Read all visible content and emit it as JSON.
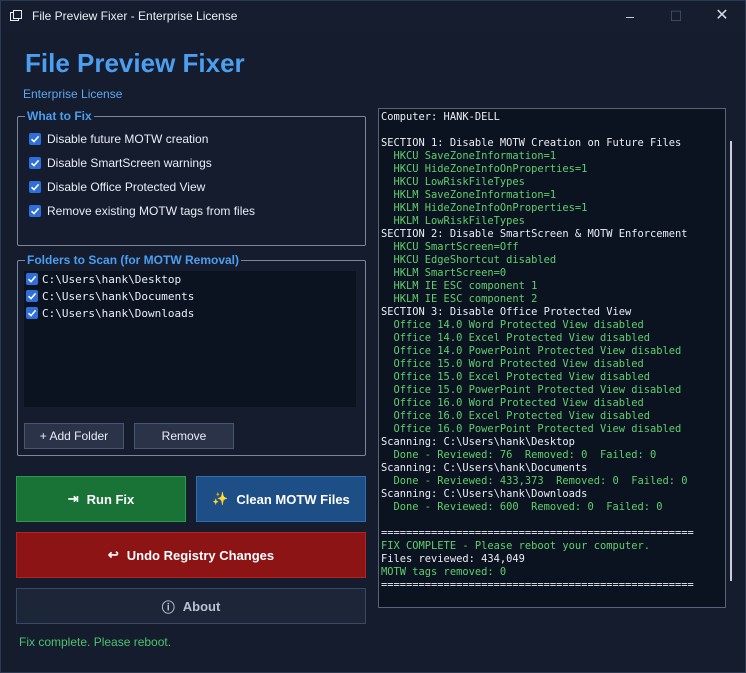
{
  "window": {
    "title": "File Preview Fixer - Enterprise License",
    "minimize_glyph": "–",
    "maximize_glyph": "☐",
    "close_glyph": "✕"
  },
  "header": {
    "title": "File Preview Fixer",
    "subtitle": "Enterprise License"
  },
  "what_to_fix": {
    "legend": "What to Fix",
    "options": [
      {
        "label": "Disable future MOTW creation",
        "checked": true
      },
      {
        "label": "Disable SmartScreen warnings",
        "checked": true
      },
      {
        "label": "Disable Office Protected View",
        "checked": true
      },
      {
        "label": "Remove existing MOTW tags from files",
        "checked": true
      }
    ]
  },
  "folders": {
    "legend": "Folders to Scan (for MOTW Removal)",
    "items": [
      {
        "path": "C:\\Users\\hank\\Desktop",
        "checked": true
      },
      {
        "path": "C:\\Users\\hank\\Documents",
        "checked": true
      },
      {
        "path": "C:\\Users\\hank\\Downloads",
        "checked": true
      }
    ],
    "add_label": "+ Add Folder",
    "remove_label": "Remove"
  },
  "actions": {
    "run_label": "Run Fix",
    "run_icon": "⇥",
    "clean_label": "Clean MOTW Files",
    "clean_icon": "✨",
    "undo_label": "Undo Registry Changes",
    "undo_icon": "↩",
    "about_label": "About",
    "about_icon": "ⓘ"
  },
  "status": "Fix complete. Please reboot.",
  "colors": {
    "accent": "#4c9ef0",
    "run": "#197336",
    "clean": "#1d4f86",
    "undo": "#8c1414",
    "log_green": "#5fcf6f"
  },
  "log": [
    {
      "text": "Computer: HANK-DELL",
      "tone": "white"
    },
    {
      "text": "",
      "tone": "white"
    },
    {
      "text": "SECTION 1: Disable MOTW Creation on Future Files",
      "tone": "white"
    },
    {
      "text": "  HKCU SaveZoneInformation=1",
      "tone": "green"
    },
    {
      "text": "  HKCU HideZoneInfoOnProperties=1",
      "tone": "green"
    },
    {
      "text": "  HKCU LowRiskFileTypes",
      "tone": "green"
    },
    {
      "text": "  HKLM SaveZoneInformation=1",
      "tone": "green"
    },
    {
      "text": "  HKLM HideZoneInfoOnProperties=1",
      "tone": "green"
    },
    {
      "text": "  HKLM LowRiskFileTypes",
      "tone": "green"
    },
    {
      "text": "SECTION 2: Disable SmartScreen & MOTW Enforcement",
      "tone": "white"
    },
    {
      "text": "  HKCU SmartScreen=Off",
      "tone": "green"
    },
    {
      "text": "  HKCU EdgeShortcut disabled",
      "tone": "green"
    },
    {
      "text": "  HKLM SmartScreen=0",
      "tone": "green"
    },
    {
      "text": "  HKLM IE ESC component 1",
      "tone": "green"
    },
    {
      "text": "  HKLM IE ESC component 2",
      "tone": "green"
    },
    {
      "text": "SECTION 3: Disable Office Protected View",
      "tone": "white"
    },
    {
      "text": "  Office 14.0 Word Protected View disabled",
      "tone": "green"
    },
    {
      "text": "  Office 14.0 Excel Protected View disabled",
      "tone": "green"
    },
    {
      "text": "  Office 14.0 PowerPoint Protected View disabled",
      "tone": "green"
    },
    {
      "text": "  Office 15.0 Word Protected View disabled",
      "tone": "green"
    },
    {
      "text": "  Office 15.0 Excel Protected View disabled",
      "tone": "green"
    },
    {
      "text": "  Office 15.0 PowerPoint Protected View disabled",
      "tone": "green"
    },
    {
      "text": "  Office 16.0 Word Protected View disabled",
      "tone": "green"
    },
    {
      "text": "  Office 16.0 Excel Protected View disabled",
      "tone": "green"
    },
    {
      "text": "  Office 16.0 PowerPoint Protected View disabled",
      "tone": "green"
    },
    {
      "text": "Scanning: C:\\Users\\hank\\Desktop",
      "tone": "white"
    },
    {
      "text": "  Done - Reviewed: 76  Removed: 0  Failed: 0",
      "tone": "green"
    },
    {
      "text": "Scanning: C:\\Users\\hank\\Documents",
      "tone": "white"
    },
    {
      "text": "  Done - Reviewed: 433,373  Removed: 0  Failed: 0",
      "tone": "green"
    },
    {
      "text": "Scanning: C:\\Users\\hank\\Downloads",
      "tone": "white"
    },
    {
      "text": "  Done - Reviewed: 600  Removed: 0  Failed: 0",
      "tone": "green"
    },
    {
      "text": "",
      "tone": "white"
    },
    {
      "text": "==================================================",
      "tone": "white"
    },
    {
      "text": "FIX COMPLETE - Please reboot your computer.",
      "tone": "green"
    },
    {
      "text": "Files reviewed: 434,049",
      "tone": "white"
    },
    {
      "text": "MOTW tags removed: 0",
      "tone": "green"
    },
    {
      "text": "==================================================",
      "tone": "white"
    }
  ]
}
